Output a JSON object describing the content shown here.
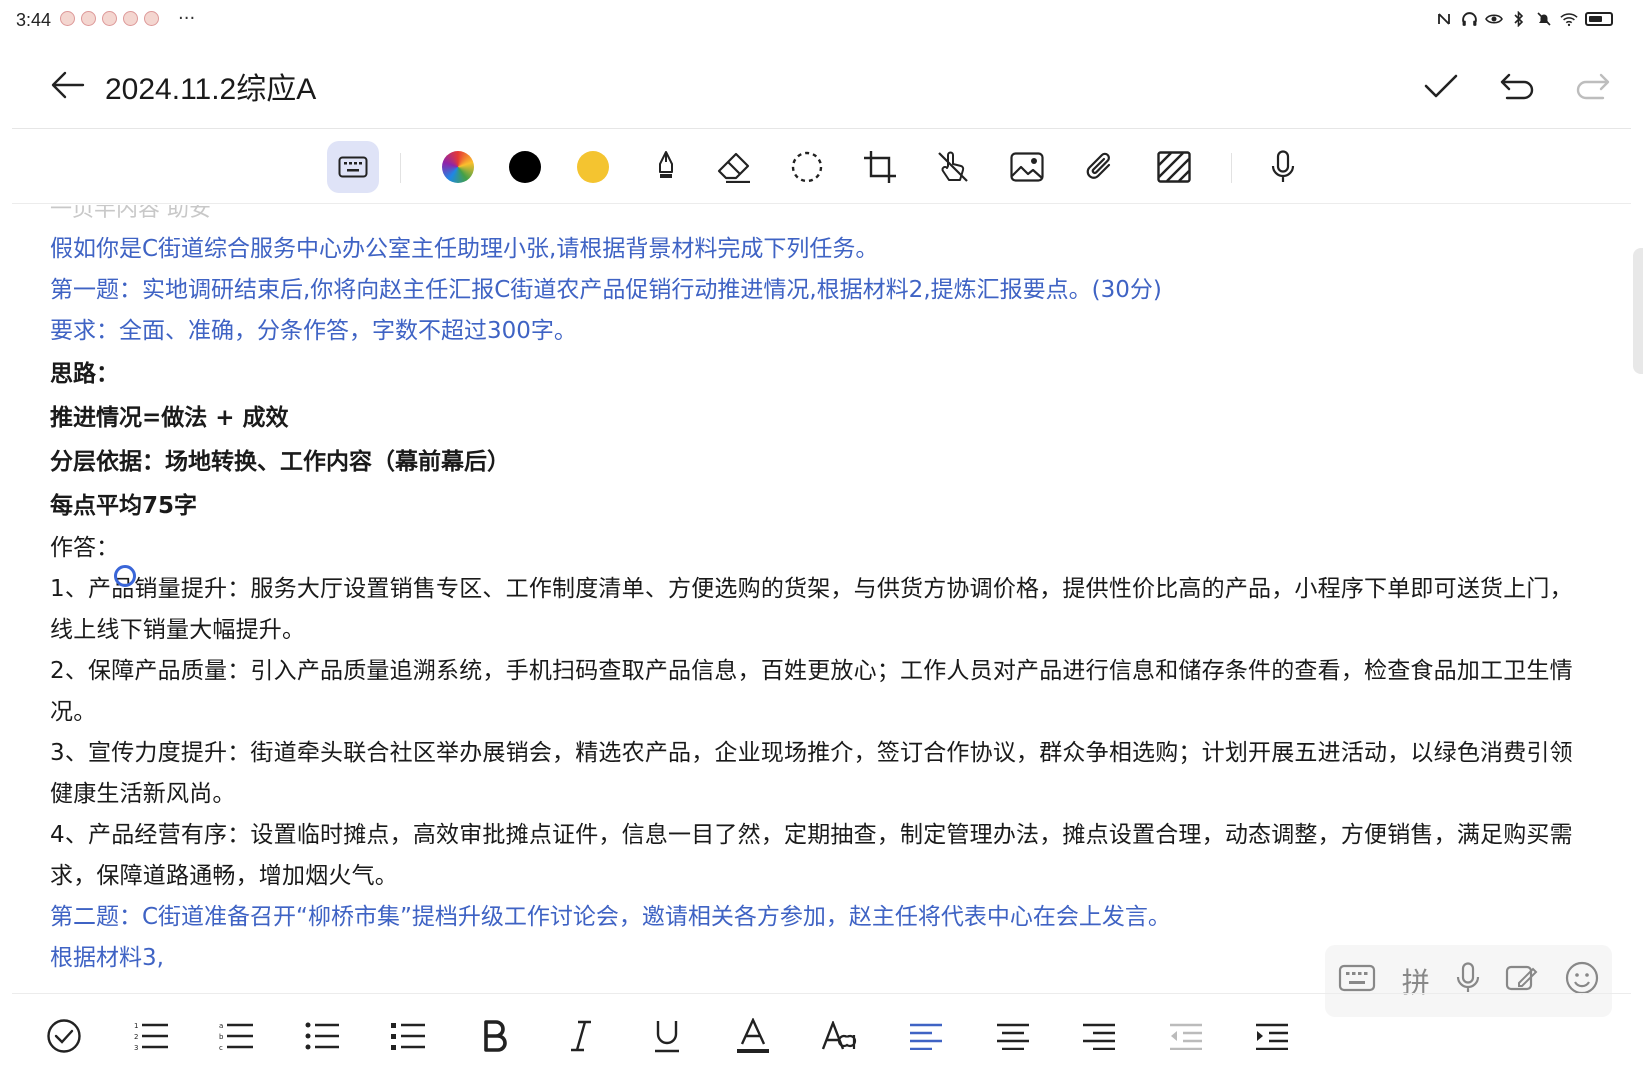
{
  "status": {
    "time": "3:44",
    "more": "···"
  },
  "title": {
    "text": "2024.11.2综应A"
  },
  "ime": {
    "pinyin": "拼"
  },
  "content": {
    "ghost": "一页半内容   助安",
    "lines": [
      "假如你是C街道综合服务中心办公室主任助理小张,请根据背景材料完成下列任务。",
      "第一题：实地调研结束后,你将向赵主任汇报C街道农产品促销行动推进情况,根据材料2,提炼汇报要点。(30分)",
      "要求：全面、准确，分条作答，字数不超过300字。",
      "思路：",
      "推进情况=做法 + 成效",
      "分层依据：场地转换、工作内容（幕前幕后）",
      "每点平均75字",
      "作答：",
      "1、产品销量提升：服务大厅设置销售专区、工作制度清单、方便选购的货架，与供货方协调价格，提供性价比高的产品，小程序下单即可送货上门，线上线下销量大幅提升。",
      "2、保障产品质量：引入产品质量追溯系统，手机扫码查取产品信息，百姓更放心；工作人员对产品进行信息和储存条件的查看，检查食品加工卫生情况。",
      "3、宣传力度提升：街道牵头联合社区举办展销会，精选农产品，企业现场推介，签订合作协议，群众争相选购；计划开展五进活动，以绿色消费引领健康生活新风尚。",
      "4、产品经营有序：设置临时摊点，高效审批摊点证件，信息一目了然，定期抽查，制定管理办法，摊点设置合理，动态调整，方便销售，满足购买需求，保障道路通畅，增加烟火气。",
      "第二题：C街道准备召开“柳桥市集”提档升级工作讨论会，邀请相关各方参加，赵主任将代表中心在会上发言。",
      "根据材料3,"
    ]
  },
  "colors": {
    "accent": "#3f63c4",
    "active_tool_bg": "#dfe3f7",
    "pen_black": "#000000",
    "pen_yellow": "#f4c430"
  }
}
